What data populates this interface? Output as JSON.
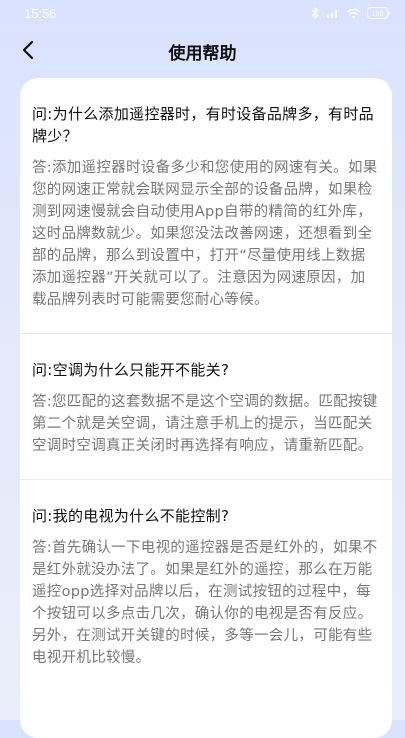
{
  "status_bar": {
    "time": "15:56",
    "icons": [
      "bluetooth-icon",
      "signal-icon",
      "wifi-icon",
      "battery-icon"
    ],
    "battery_label": "100"
  },
  "header": {
    "back_icon": "chevron-left-icon",
    "title": "使用帮助"
  },
  "faq": [
    {
      "question": "问:为什么添加遥控器时，有时设备品牌多，有时品牌少？",
      "answer": "答:添加遥控器时设备多少和您使用的网速有关。如果您的网速正常就会联网显示全部的设备品牌，如果检测到网速慢就会自动使用App自带的精简的红外库，这时品牌数就少。如果您没法改善网速，还想看到全部的品牌，那么到设置中，打开“尽量使用线上数据添加遥控器”开关就可以了。注意因为网速原因，加载品牌列表时可能需要您耐心等候。"
    },
    {
      "question": "问:空调为什么只能开不能关?",
      "answer": "答:您匹配的这套数据不是这个空调的数据。匹配按键第二个就是关空调，请注意手机上的提示，当匹配关空调时空调真正关闭时再选择有响应，请重新匹配。"
    },
    {
      "question": "问:我的电视为什么不能控制?",
      "answer": "答:首先确认一下电视的遥控器是否是红外的，如果不是红外就没办法了。如果是红外的遥控，那么在万能遥控opp选择对品牌以后，在测试按钮的过程中，每个按钮可以多点击几次，确认你的电视是否有反应。另外，在测试开关键的时候，多等一会儿，可能有些电视开机比较慢。"
    }
  ],
  "colors": {
    "background_gradient_top": "#d9e2ff",
    "card": "#ffffff",
    "question_text": "#111111",
    "answer_text": "#777777"
  }
}
